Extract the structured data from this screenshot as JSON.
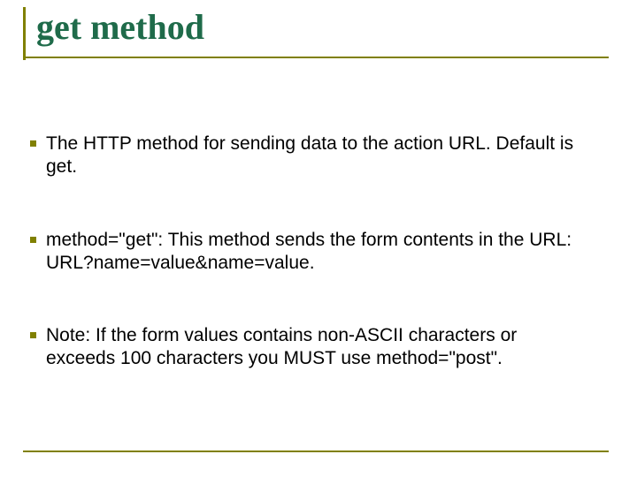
{
  "title": "get method",
  "paragraphs": [
    "The HTTP method for sending data to the action URL. Default is get.",
    "method=\"get\": This method sends the form contents in the URL: URL?name=value&name=value.",
    "Note: If the form values contains non-ASCII characters or exceeds 100 characters you MUST use method=\"post\"."
  ]
}
